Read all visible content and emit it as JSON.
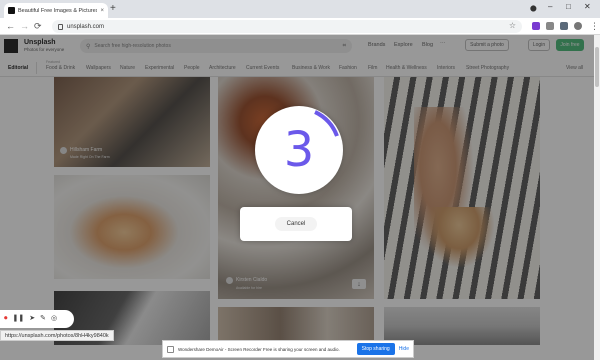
{
  "browser": {
    "tab_title": "Beautiful Free Images & Pictures",
    "tab_close": "×",
    "new_tab": "+",
    "url": "unsplash.com",
    "back": "←",
    "forward": "→",
    "reload": "⟳",
    "star": "☆",
    "menu": "⋮",
    "minimize": "–",
    "maximize": "□",
    "close": "✕"
  },
  "header": {
    "brand": "Unsplash",
    "brand_sub": "Photos for everyone",
    "search_placeholder": "Search free high-resolution photos",
    "nav": [
      "Brands",
      "Explore",
      "Blog"
    ],
    "more": "···",
    "submit_label": "Submit a photo",
    "login_label": "Login",
    "join_label": "Join free"
  },
  "categories": {
    "editorial": "Editorial",
    "featured_label": "Featured",
    "items": [
      "Food & Drink",
      "Wallpapers",
      "Nature",
      "Experimental",
      "People",
      "Architecture",
      "Current Events",
      "Business & Work",
      "Fashion",
      "Film",
      "Health & Wellness",
      "Interiors",
      "Street Photography"
    ],
    "view_all": "View all"
  },
  "photos": {
    "food_credit": "Hillsham Farm",
    "food_credit_sub": "Made Right On The Farm",
    "drinks_credit": "Kirsten Cialdo",
    "drinks_credit_sub": "Available for hire"
  },
  "overlay": {
    "countdown": "3",
    "cancel_label": "Cancel"
  },
  "recorder": {
    "icons": [
      "record-icon",
      "pause-icon",
      "pointer-icon",
      "pen-icon",
      "webcam-icon"
    ]
  },
  "status": {
    "url": "https://unsplash.com/photos/8hH4ky9840k"
  },
  "sharing": {
    "text": "Wondershare DemoAir - Screen Recorder Free is sharing your screen and audio.",
    "stop_label": "Stop sharing",
    "hide_label": "Hide"
  },
  "colors": {
    "countdown_accent": "#6b59ea",
    "join_green": "#3cb46e",
    "stop_blue": "#1a73e8"
  }
}
